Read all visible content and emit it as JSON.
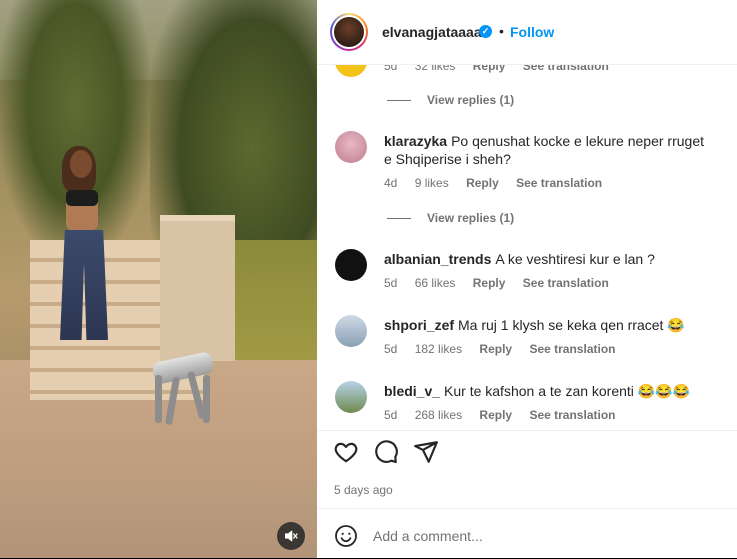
{
  "header": {
    "username": "elvanagjataaaa",
    "separator": "•",
    "follow_label": "Follow",
    "verified_icon": "verified-badge-icon"
  },
  "partial_comment": {
    "meta": {
      "time": "5d",
      "likes": "32 likes",
      "reply": "Reply",
      "translation": "See translation"
    }
  },
  "comments": [
    {
      "view_replies": "View replies (1)"
    },
    {
      "username": "klarazyka",
      "text": "Po qenushat kocke e lekure neper rruget e Shqiperise i sheh?",
      "time": "4d",
      "likes": "9 likes",
      "reply": "Reply",
      "translation": "See translation",
      "view_replies": "View replies (1)"
    },
    {
      "username": "albanian_trends",
      "text": "A ke veshtiresi kur e lan ?",
      "time": "5d",
      "likes": "66 likes",
      "reply": "Reply",
      "translation": "See translation"
    },
    {
      "username": "shpori_zef",
      "text": "Ma ruj 1 klysh se keka qen rracet 😂",
      "time": "5d",
      "likes": "182 likes",
      "reply": "Reply",
      "translation": "See translation"
    },
    {
      "username": "bledi_v_",
      "text": "Kur te kafshon a te zan korenti 😂😂😂",
      "time": "5d",
      "likes": "268 likes",
      "reply": "Reply",
      "translation": "See translation"
    }
  ],
  "actions": {
    "like_icon": "heart-icon",
    "comment_icon": "comment-bubble-icon",
    "share_icon": "paper-plane-icon"
  },
  "post_date": "5 days ago",
  "add_comment": {
    "placeholder": "Add a comment...",
    "emoji_icon": "smiley-icon"
  },
  "media": {
    "mute_icon": "muted-speaker-icon"
  },
  "colors": {
    "accent": "#0095f6",
    "text": "#262626",
    "secondary": "#737373",
    "border": "#efefef"
  }
}
